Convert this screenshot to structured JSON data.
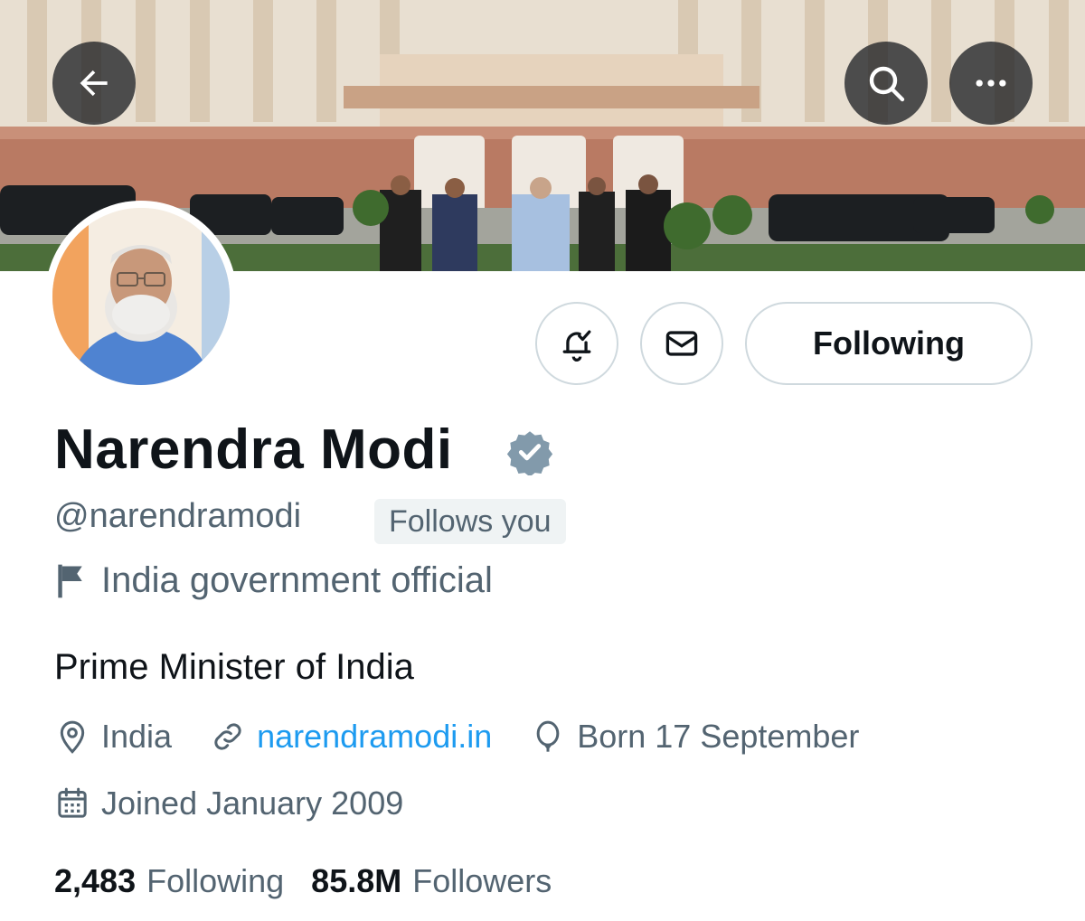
{
  "header": {
    "back_icon": "arrow-left-icon",
    "search_icon": "search-icon",
    "more_icon": "more-horizontal-icon"
  },
  "profile": {
    "name": "Narendra Modi",
    "handle": "@narendramodi",
    "follows_you": "Follows you",
    "affiliation": "India government official",
    "bio": "Prime Minister of India",
    "location": "India",
    "website": "narendramodi.in",
    "birthday": "Born 17 September",
    "joined": "Joined January 2009",
    "following_count": "2,483",
    "following_label": "Following",
    "followers_count": "85.8M",
    "followers_label": "Followers"
  },
  "actions": {
    "notify_icon": "bell-check-icon",
    "message_icon": "envelope-icon",
    "follow_button": "Following"
  },
  "colors": {
    "text_primary": "#0f1419",
    "text_secondary": "#536471",
    "link": "#1d9bf0",
    "border": "#cfd9de",
    "verified_badge": "#829aab"
  }
}
